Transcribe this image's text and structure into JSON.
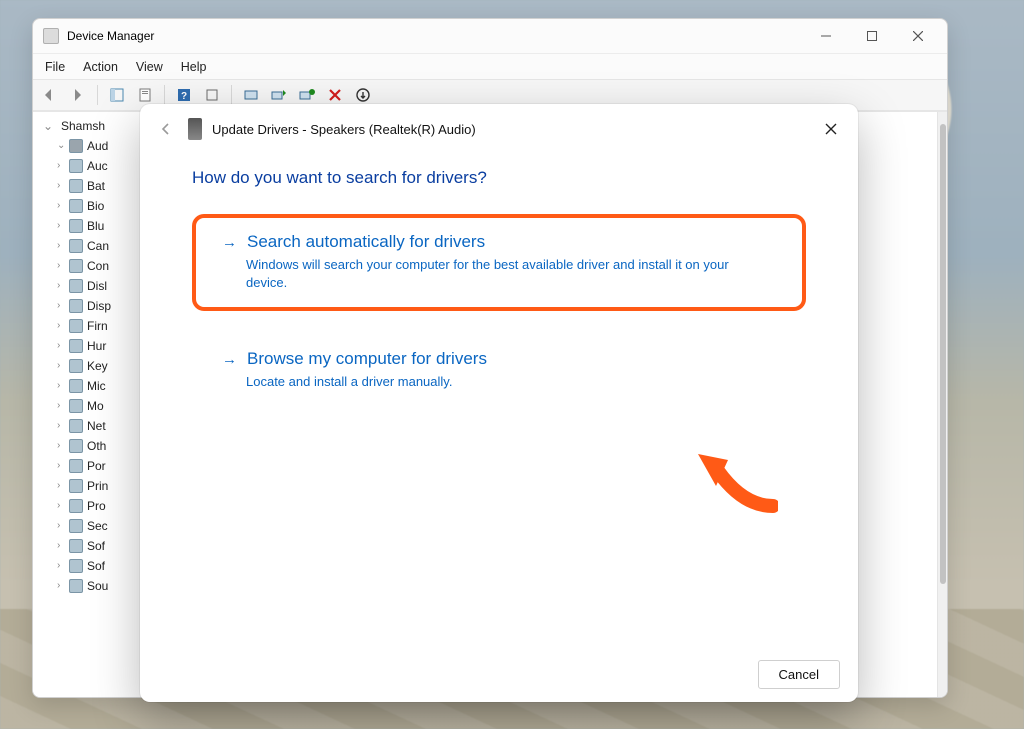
{
  "dm": {
    "title": "Device Manager",
    "menu": {
      "file": "File",
      "action": "Action",
      "view": "View",
      "help": "Help"
    },
    "tree": {
      "root": "Shamsh",
      "audioCategory": "Aud",
      "items": [
        "Auc",
        "Bat",
        "Bio",
        "Blu",
        "Can",
        "Con",
        "Disl",
        "Disp",
        "Firn",
        "Hur",
        "Key",
        "Mic",
        "Mo",
        "Net",
        "Oth",
        "Por",
        "Prin",
        "Pro",
        "Sec",
        "Sof",
        "Sof",
        "Sou"
      ]
    }
  },
  "dlg": {
    "title": "Update Drivers - Speakers (Realtek(R) Audio)",
    "heading": "How do you want to search for drivers?",
    "opt1_title": "Search automatically for drivers",
    "opt1_desc": "Windows will search your computer for the best available driver and install it on your device.",
    "opt2_title": "Browse my computer for drivers",
    "opt2_desc": "Locate and install a driver manually.",
    "cancel": "Cancel"
  },
  "highlight_color": "#ff5a16"
}
